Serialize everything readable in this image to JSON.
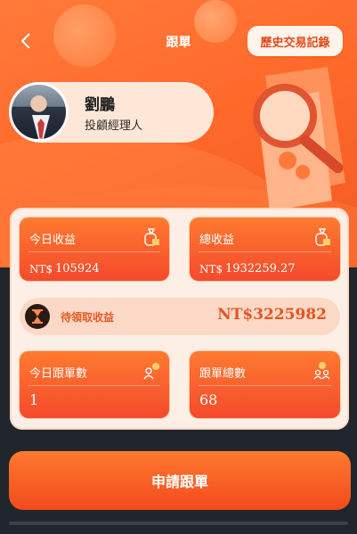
{
  "header": {
    "title": "跟單",
    "history_button": "歷史交易記錄"
  },
  "profile": {
    "name": "劉鵬",
    "role": "投顧經理人"
  },
  "stats": {
    "today_income": {
      "label": "今日收益",
      "currency": "NT$",
      "value": "105924"
    },
    "total_income": {
      "label": "總收益",
      "currency": "NT$",
      "value": "1932259.27"
    },
    "pending": {
      "label": "待領取收益",
      "value": "NT$3225982"
    },
    "today_orders": {
      "label": "今日跟單數",
      "value": "1"
    },
    "total_orders": {
      "label": "跟單總數",
      "value": "68"
    }
  },
  "actions": {
    "apply": "申請跟單"
  },
  "colors": {
    "accent": "#ff6a2b",
    "accent_dark": "#f24a1d",
    "panel_bg": "#fdefe6",
    "page_bg": "#20262c"
  },
  "icons": {
    "back": "chevron-left-icon",
    "money_bag": "money-bag-icon",
    "hourglass": "hourglass-icon",
    "user": "user-icon",
    "users": "users-icon",
    "magnifier": "magnifier-illustration"
  }
}
